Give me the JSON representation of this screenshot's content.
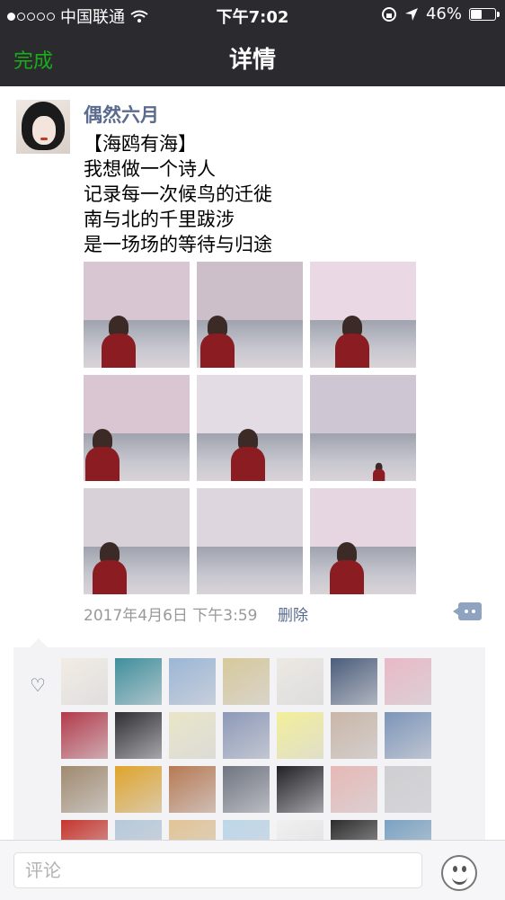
{
  "status_bar": {
    "carrier": "中国联通",
    "time": "下午7:02",
    "battery": "46%",
    "battery_level": 0.46,
    "signal_bars": 1
  },
  "nav": {
    "done_label": "完成",
    "title": "详情"
  },
  "post": {
    "username": "偶然六月",
    "text_lines": [
      "【海鸥有海】",
      "我想做一个诗人",
      "记录每一次候鸟的迁徙",
      "南与北的千里跋涉",
      "是一场场的等待与归途"
    ],
    "timestamp": "2017年4月6日 下午3:59",
    "delete_label": "删除"
  },
  "comment": {
    "placeholder": "评论"
  },
  "colors": {
    "nav_bg": "#2b2b2f",
    "accent_green": "#1aad19",
    "link_blue": "#5a6b8e"
  }
}
